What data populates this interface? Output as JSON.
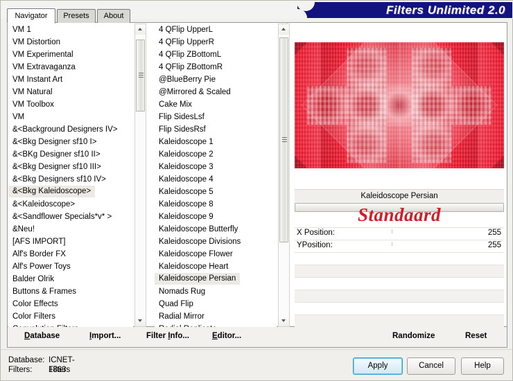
{
  "window": {
    "title": "Filters Unlimited 2.0",
    "title_bg": "#131380",
    "title_color": "#ffffff"
  },
  "tabs": [
    {
      "label": "Navigator",
      "active": true
    },
    {
      "label": "Presets",
      "active": false
    },
    {
      "label": "About",
      "active": false
    }
  ],
  "category_list": {
    "selected": "&<Bkg Kaleidoscope>",
    "items": [
      "VM 1",
      "VM Distortion",
      "VM Experimental",
      "VM Extravaganza",
      "VM Instant Art",
      "VM Natural",
      "VM Toolbox",
      "VM",
      "&<Background Designers IV>",
      "&<Bkg Designer sf10 I>",
      "&<BKg Designer sf10 II>",
      "&<Bkg Designer sf10 III>",
      "&<Bkg Designers sf10 IV>",
      "&<Bkg Kaleidoscope>",
      "&<Kaleidoscope>",
      "&<Sandflower Specials*v* >",
      "&Neu!",
      "[AFS IMPORT]",
      "Alf's Border FX",
      "Alf's Power Toys",
      "Balder Olrik",
      "Buttons & Frames",
      "Color Effects",
      "Color Filters",
      "Convolution Filters"
    ]
  },
  "filter_list": {
    "selected": "Kaleidoscope Persian",
    "items": [
      "4 QFlip UpperL",
      "4 QFlip UpperR",
      "4 QFlip ZBottomL",
      "4 QFlip ZBottomR",
      "@BlueBerry Pie",
      "@Mirrored & Scaled",
      "Cake Mix",
      "Flip SidesLsf",
      "Flip SidesRsf",
      "Kaleidoscope 1",
      "Kaleidoscope 2",
      "Kaleidoscope 3",
      "Kaleidoscope 4",
      "Kaleidoscope 5",
      "Kaleidoscope 8",
      "Kaleidoscope 9",
      "Kaleidoscope Butterfly",
      "Kaleidoscope Divisions",
      "Kaleidoscope Flower",
      "Kaleidoscope Heart",
      "Kaleidoscope Persian",
      "Nomads Rug",
      "Quad Flip",
      "Radial Mirror",
      "Radial Replicate"
    ]
  },
  "preview": {
    "filter_name": "Kaleidoscope Persian",
    "overlay_text": "Standaard",
    "overlay_color": "#d51b25",
    "dominant_color": "#e8102a"
  },
  "parameters": [
    {
      "label": "X Position:",
      "value": "255"
    },
    {
      "label": "YPosition:",
      "value": "255"
    }
  ],
  "link_bar": {
    "database": {
      "pre": "",
      "accel": "D",
      "post": "atabase"
    },
    "import": {
      "pre": "",
      "accel": "I",
      "post": "mport..."
    },
    "filter_info": {
      "pre": "Filter ",
      "accel": "I",
      "post": "nfo..."
    },
    "editor": {
      "pre": "",
      "accel": "E",
      "post": "ditor..."
    },
    "randomize": "Randomize",
    "reset": "Reset"
  },
  "status": {
    "database_label": "Database:",
    "database_value": "ICNET-Filters",
    "filters_label": "Filters:",
    "filters_value": "1863"
  },
  "dialog_buttons": {
    "apply": "Apply",
    "cancel": "Cancel",
    "help": "Help"
  }
}
